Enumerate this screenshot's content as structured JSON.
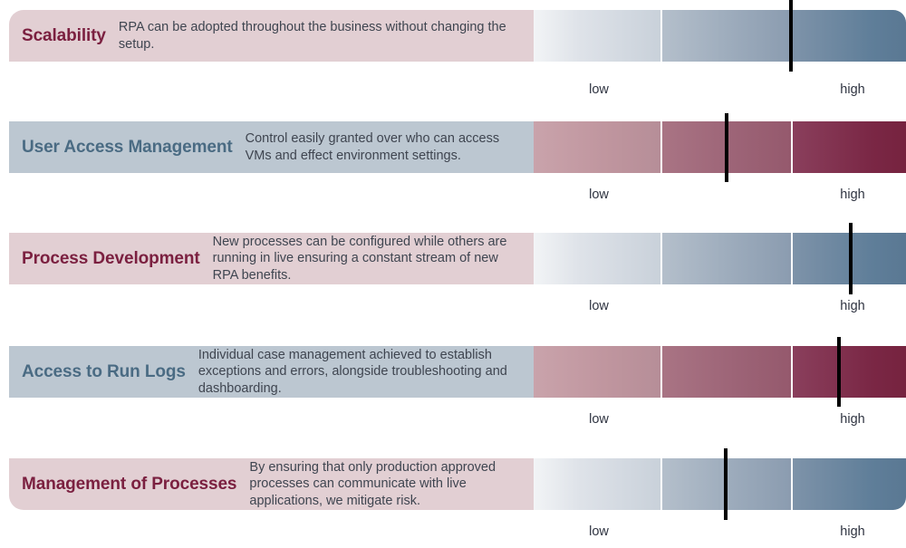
{
  "chart_data": {
    "type": "bar",
    "title": "",
    "xlabel": "",
    "ylabel": "",
    "scale_labels": {
      "low": "low",
      "high": "high"
    },
    "scale_range": [
      0,
      100
    ],
    "segments": 3,
    "categories": [
      "Scalability",
      "User Access Management",
      "Process Development",
      "Access to Run Logs",
      "Management of Processes"
    ],
    "values": [
      69,
      52,
      85,
      82,
      52
    ]
  },
  "rows": [
    {
      "title": "Scalability",
      "description": "RPA can be adopted throughout the business without changing the setup.",
      "theme": "rose",
      "bar_theme": "steelbar",
      "marker_value": 69,
      "low_label": "low",
      "high_label": "high"
    },
    {
      "title": "User Access Management",
      "description": "Control easily granted over who can access VMs and effect environment settings.",
      "theme": "steel",
      "bar_theme": "rosebar",
      "marker_value": 52,
      "low_label": "low",
      "high_label": "high"
    },
    {
      "title": "Process Development",
      "description": "New processes can be configured while others are running in live ensuring a constant stream of new RPA benefits.",
      "theme": "rose",
      "bar_theme": "steelbar",
      "marker_value": 85,
      "low_label": "low",
      "high_label": "high"
    },
    {
      "title": "Access to Run Logs",
      "description": "Individual case management achieved to establish exceptions and errors, alongside troubleshooting and dashboarding.",
      "theme": "steel",
      "bar_theme": "rosebar",
      "marker_value": 82,
      "low_label": "low",
      "high_label": "high"
    },
    {
      "title": "Management of Processes",
      "description": "By ensuring that only production approved processes can communicate with live applications, we mitigate risk.",
      "theme": "rose",
      "bar_theme": "steelbar",
      "marker_value": 52,
      "low_label": "low",
      "high_label": "high"
    }
  ],
  "colors": {
    "rose_panel": "#e2cfd3",
    "steel_panel": "#bcc7d1",
    "rose_title": "#7b2040",
    "steel_title": "#4a6b83",
    "description": "#3f4550",
    "marker": "#000000",
    "steel_bar_high": "#5a7893",
    "rose_bar_high": "#76233f"
  }
}
